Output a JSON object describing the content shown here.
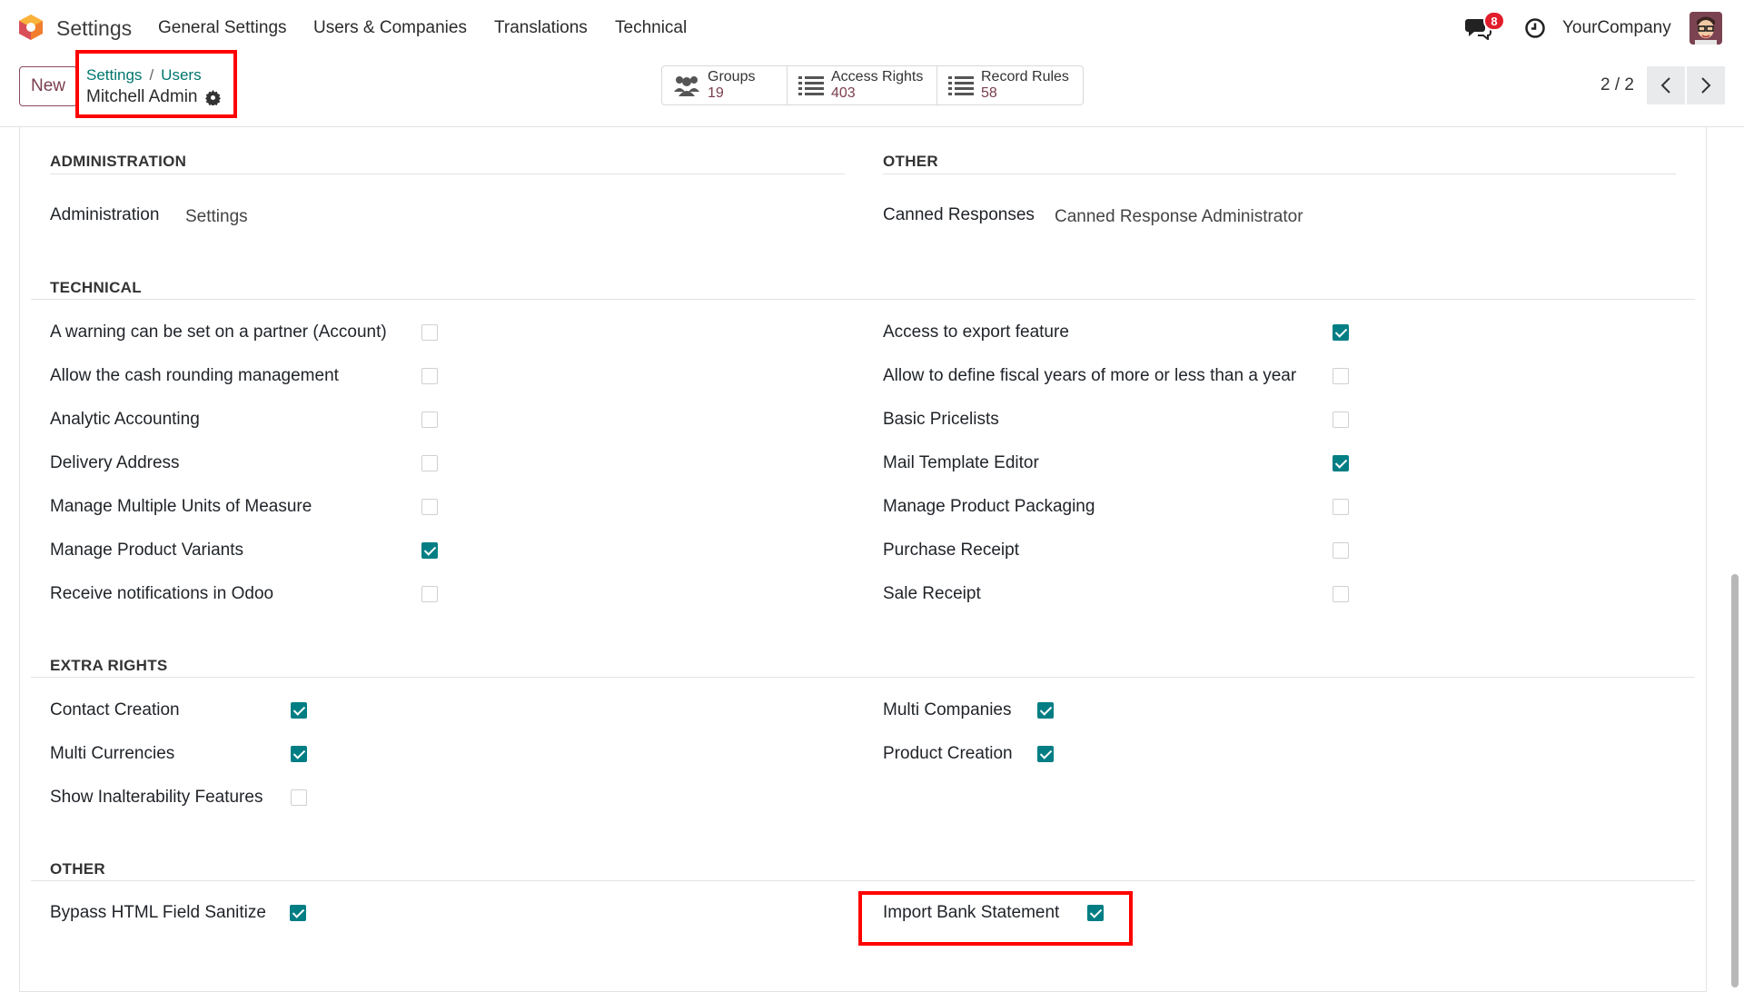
{
  "navbar": {
    "app_name": "Settings",
    "menu": [
      "General Settings",
      "Users & Companies",
      "Translations",
      "Technical"
    ],
    "notification_count": "8",
    "company": "YourCompany"
  },
  "control": {
    "new_label": "New",
    "breadcrumb": [
      "Settings",
      "Users"
    ],
    "breadcrumb_sep": "/",
    "record_title": "Mitchell Admin",
    "stats": [
      {
        "label": "Groups",
        "value": "19",
        "icon": "users-icon"
      },
      {
        "label": "Access Rights",
        "value": "403",
        "icon": "list-icon"
      },
      {
        "label": "Record Rules",
        "value": "58",
        "icon": "list-icon"
      }
    ],
    "pager": "2 / 2"
  },
  "sections": {
    "administration": {
      "title": "ADMINISTRATION",
      "label": "Administration",
      "value": "Settings"
    },
    "other_top": {
      "title": "OTHER",
      "label": "Canned Responses",
      "value": "Canned Response Administrator"
    },
    "technical": {
      "title": "TECHNICAL",
      "left": [
        {
          "label": "A warning can be set on a partner (Account)",
          "checked": false
        },
        {
          "label": "Allow the cash rounding management",
          "checked": false
        },
        {
          "label": "Analytic Accounting",
          "checked": false
        },
        {
          "label": "Delivery Address",
          "checked": false
        },
        {
          "label": "Manage Multiple Units of Measure",
          "checked": false
        },
        {
          "label": "Manage Product Variants",
          "checked": true
        },
        {
          "label": "Receive notifications in Odoo",
          "checked": false
        }
      ],
      "right": [
        {
          "label": "Access to export feature",
          "checked": true
        },
        {
          "label": "Allow to define fiscal years of more or less than a year",
          "checked": false
        },
        {
          "label": "Basic Pricelists",
          "checked": false
        },
        {
          "label": "Mail Template Editor",
          "checked": true
        },
        {
          "label": "Manage Product Packaging",
          "checked": false
        },
        {
          "label": "Purchase Receipt",
          "checked": false
        },
        {
          "label": "Sale Receipt",
          "checked": false
        }
      ]
    },
    "extra_rights": {
      "title": "EXTRA RIGHTS",
      "left": [
        {
          "label": "Contact Creation",
          "checked": true
        },
        {
          "label": "Multi Currencies",
          "checked": true
        },
        {
          "label": "Show Inalterability Features",
          "checked": false
        }
      ],
      "right": [
        {
          "label": "Multi Companies",
          "checked": true
        },
        {
          "label": "Product Creation",
          "checked": true
        }
      ]
    },
    "other_bottom": {
      "title": "OTHER",
      "left": [
        {
          "label": "Bypass HTML Field Sanitize",
          "checked": true
        }
      ],
      "right": [
        {
          "label": "Import Bank Statement",
          "checked": true
        }
      ]
    }
  },
  "colors": {
    "accent": "#017e84",
    "brand": "#7a3e4d",
    "link": "#00766e",
    "highlight": "#ff0000"
  }
}
